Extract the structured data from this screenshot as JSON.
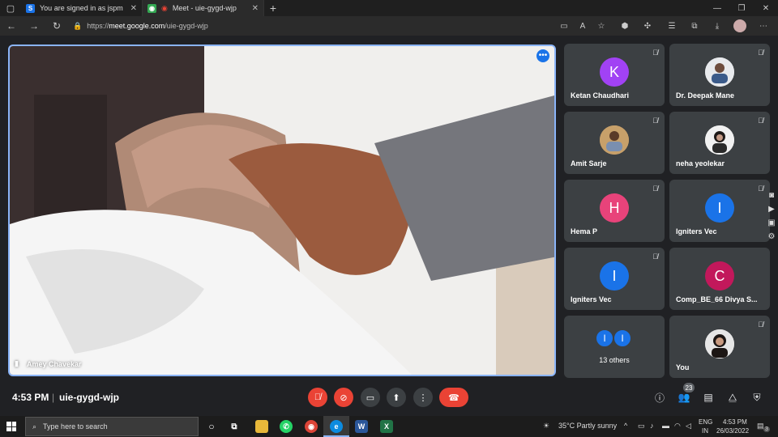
{
  "browser": {
    "tabs": [
      {
        "label": "You are signed in as jspm",
        "favicon": "S",
        "color": "#1a73e8"
      },
      {
        "label": "Meet - uie-gygd-wjp",
        "favicon": "M",
        "color": "#ea4335"
      }
    ],
    "url_scheme": "https://",
    "url_host": "meet.google.com",
    "url_path": "/uie-gygd-wjp"
  },
  "meet": {
    "main_speaker": "Amey Chavekar",
    "more_icon": "more-horiz-icon",
    "participants": [
      {
        "name": "Ketan Chaudhari",
        "initial": "K",
        "color": "#a142f4",
        "muted": true,
        "photo": false
      },
      {
        "name": "Dr. Deepak Mane",
        "initial": "",
        "color": "#e8eaed",
        "muted": true,
        "photo": true
      },
      {
        "name": "Amit Sarje",
        "initial": "",
        "color": "#c7a06a",
        "muted": true,
        "photo": true
      },
      {
        "name": "neha yeolekar",
        "initial": "",
        "color": "#f1f1f1",
        "muted": true,
        "photo": true
      },
      {
        "name": "Hema P",
        "initial": "H",
        "color": "#e8437a",
        "muted": true,
        "photo": false
      },
      {
        "name": "Igniters Vec",
        "initial": "I",
        "color": "#1a73e8",
        "muted": true,
        "photo": false
      },
      {
        "name": "Igniters Vec",
        "initial": "I",
        "color": "#1a73e8",
        "muted": true,
        "photo": false
      },
      {
        "name": "Comp_BE_66 Divya S...",
        "initial": "C",
        "color": "#c2185b",
        "muted": false,
        "photo": false
      }
    ],
    "others_label": "13 others",
    "others_initials": [
      "I",
      "I"
    ],
    "self_label": "You",
    "time": "4:53 PM",
    "meeting_code": "uie-gygd-wjp",
    "people_count": "23"
  },
  "taskbar": {
    "search_placeholder": "Type here to search",
    "weather": "35°C  Partly sunny",
    "lang_1": "ENG",
    "lang_2": "IN",
    "clock_time": "4:53 PM",
    "clock_date": "26/03/2022",
    "notif_count": "3"
  }
}
